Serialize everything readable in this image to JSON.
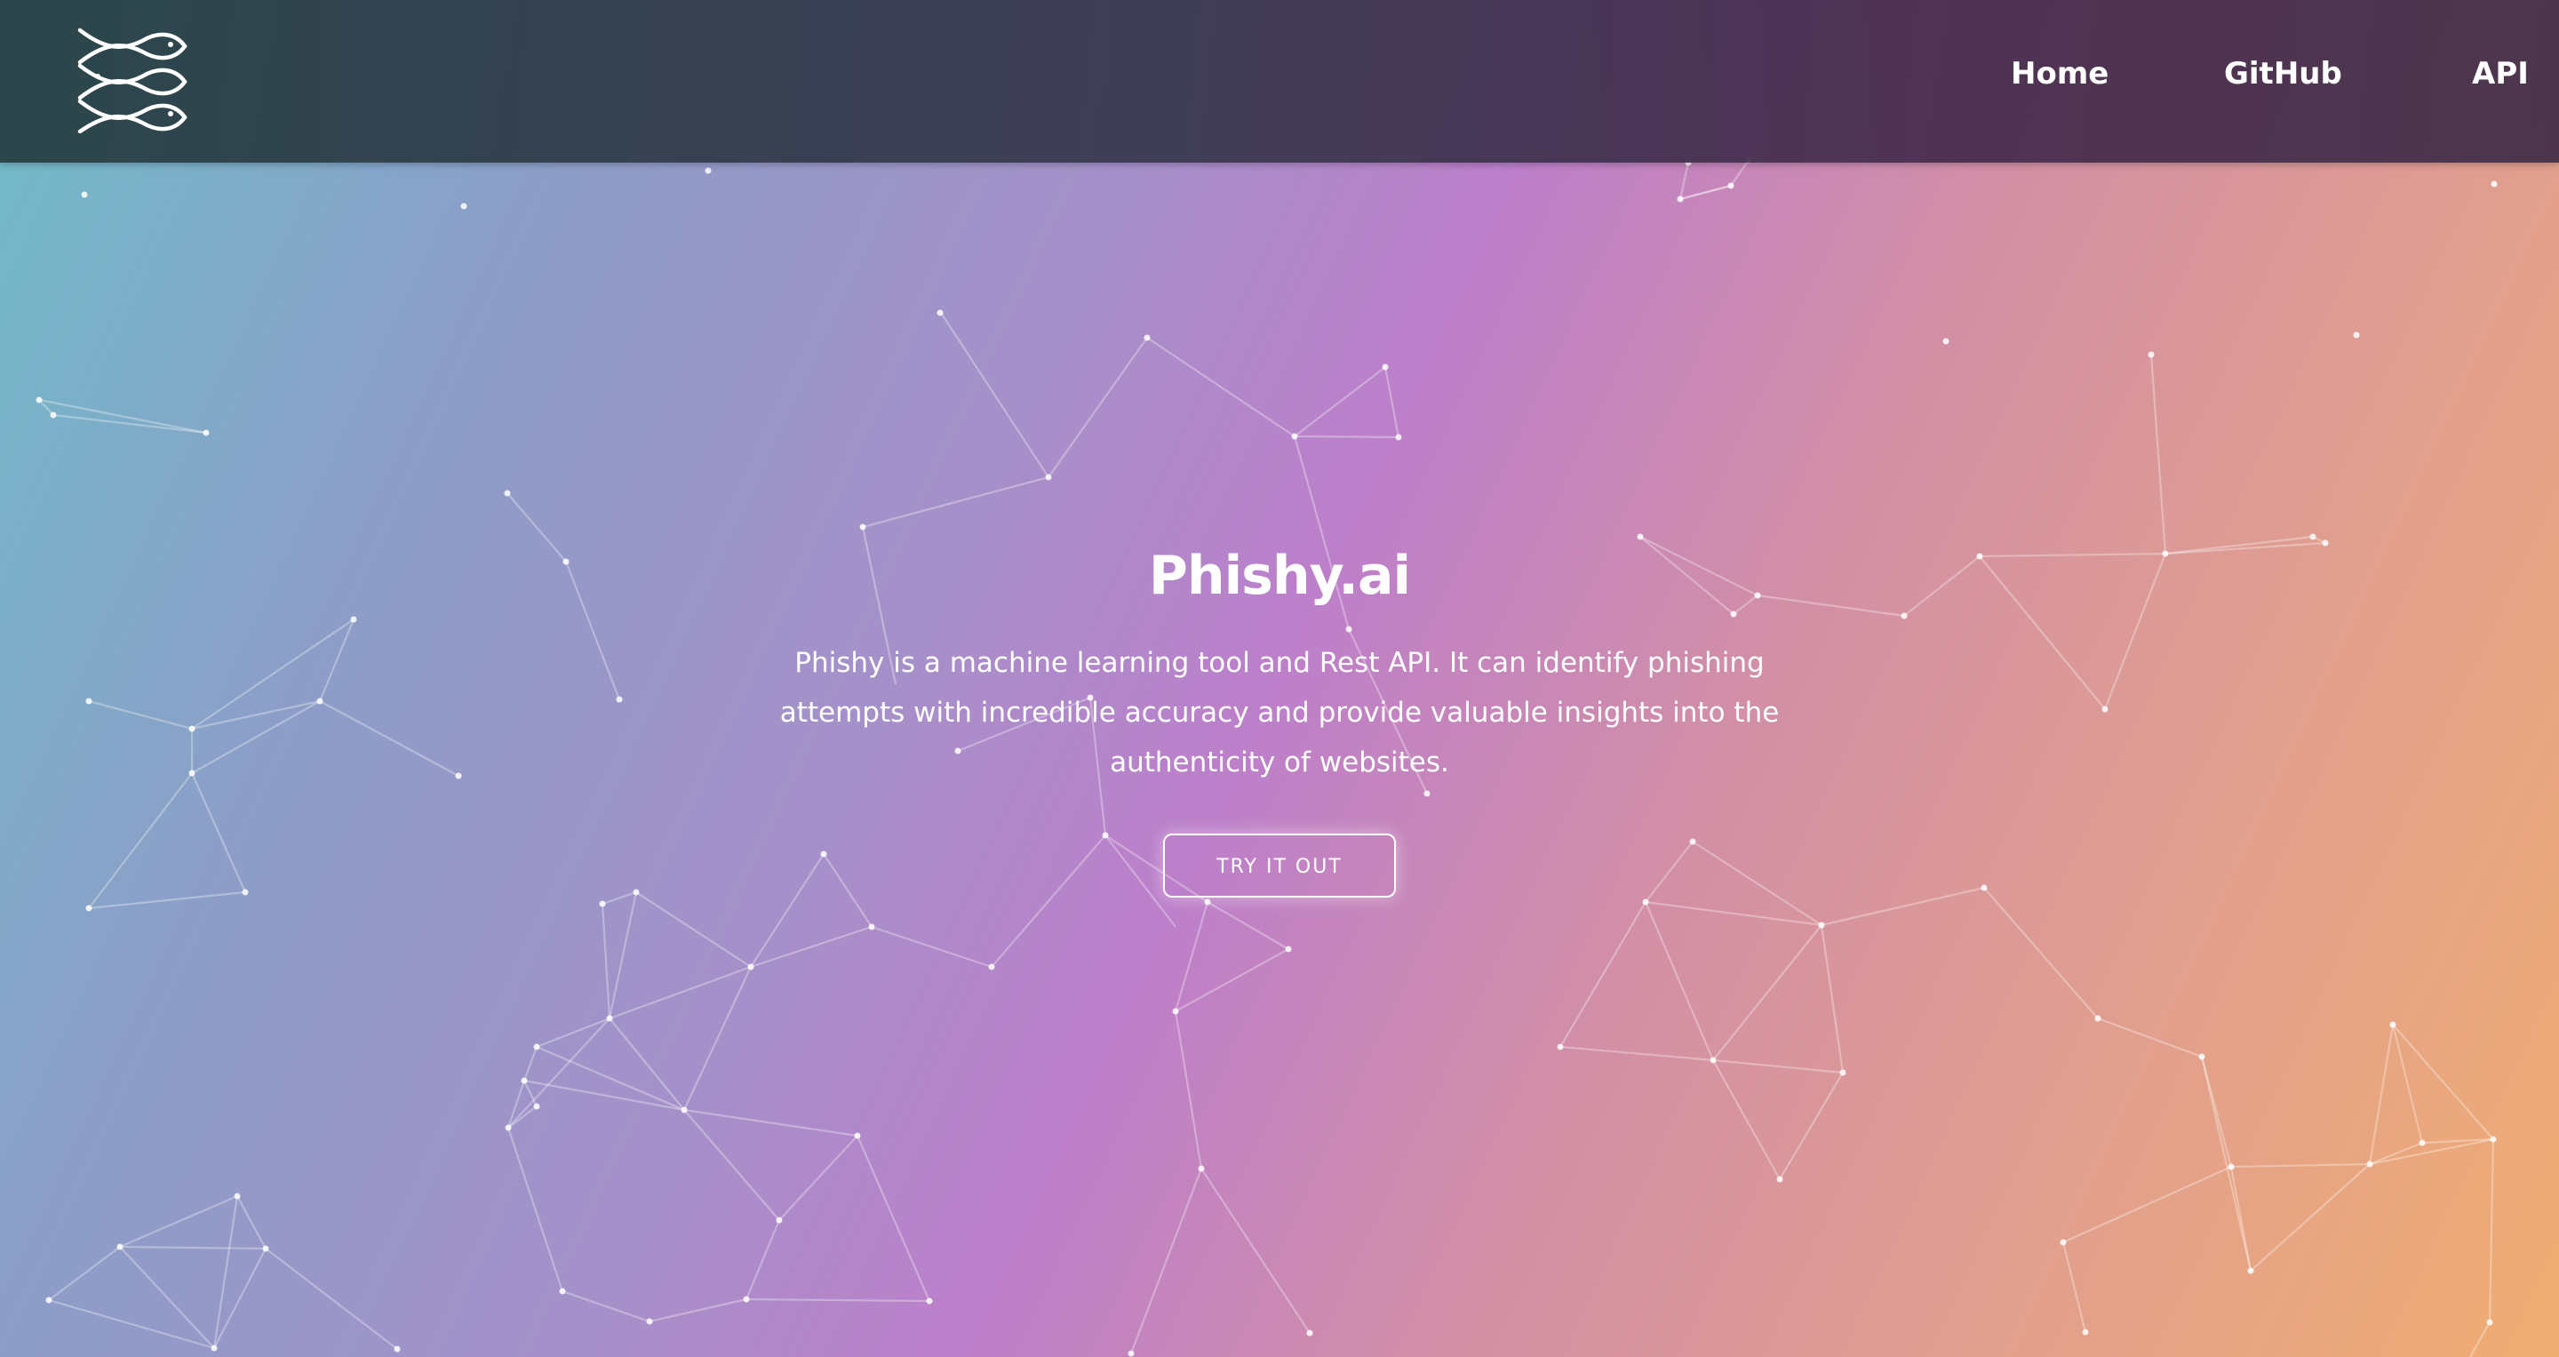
{
  "nav": {
    "logo_icon": "three-fish-icon",
    "links": [
      {
        "label": "Home"
      },
      {
        "label": "GitHub"
      },
      {
        "label": "API"
      }
    ]
  },
  "hero": {
    "title": "Phishy.ai",
    "description": "Phishy is a machine learning tool and Rest API. It can identify phishing attempts with incredible accuracy and provide valuable insights into the authenticity of websites.",
    "cta_label": "TRY IT OUT"
  },
  "colors": {
    "gradient_start": "#6fbcc8",
    "gradient_mid": "#bd7fca",
    "gradient_end": "#f0ad72",
    "navbar": "#3a3a4e",
    "text": "#ffffff"
  }
}
